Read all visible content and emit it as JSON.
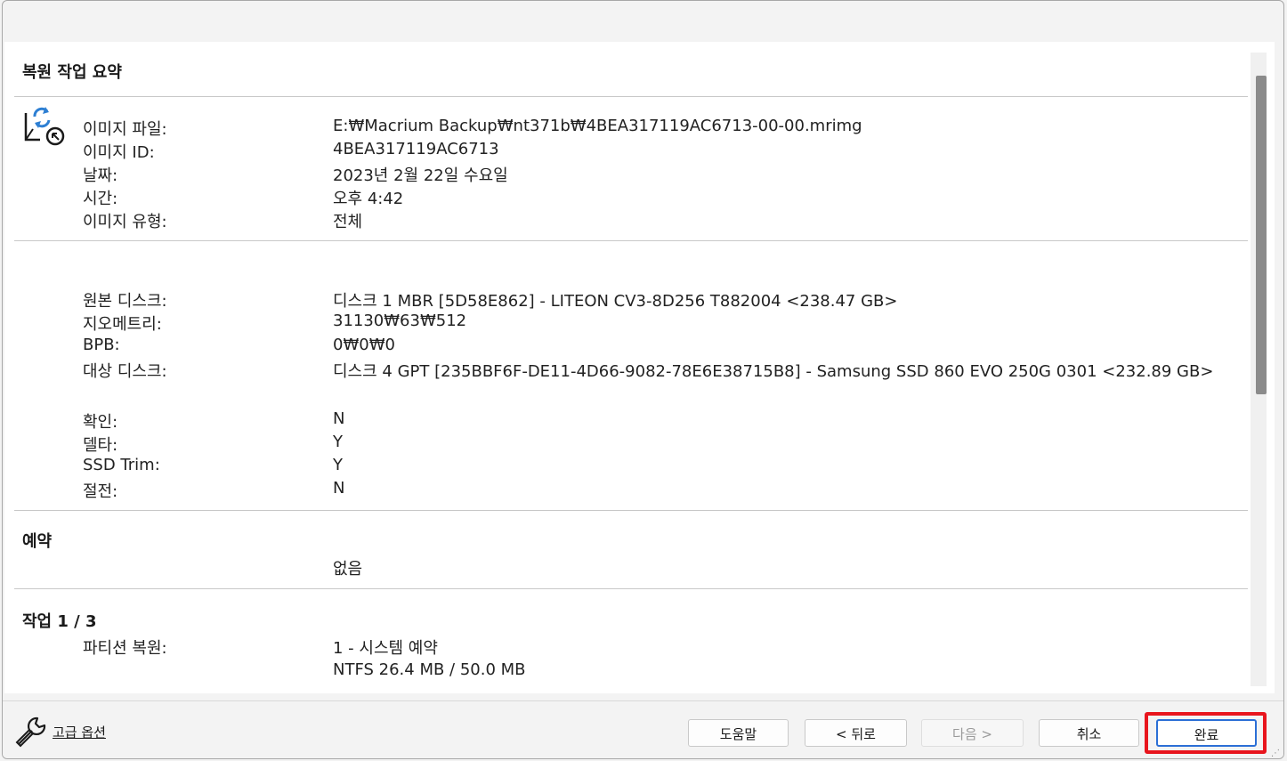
{
  "sections": {
    "summary_title": "복원 작업 요약",
    "schedule_title": "예약",
    "schedule_value": "없음",
    "task_title": "작업 1 / 3"
  },
  "image_info": [
    {
      "label": "이미지 파일:",
      "value": "E:₩Macrium Backup₩nt371b₩4BEA317119AC6713-00-00.mrimg"
    },
    {
      "label": "이미지 ID:",
      "value": "4BEA317119AC6713"
    },
    {
      "label": "날짜:",
      "value": "2023년 2월 22일 수요일"
    },
    {
      "label": "시간:",
      "value": "오후 4:42"
    },
    {
      "label": "이미지 유형:",
      "value": "전체"
    }
  ],
  "disk_info": [
    {
      "label": "원본 디스크:",
      "value": "디스크 1 MBR [5D58E862] - LITEON CV3-8D256 T882004  <238.47 GB>"
    },
    {
      "label": "지오메트리:",
      "value": "31130₩63₩512"
    },
    {
      "label": "BPB:",
      "value": "0₩0₩0"
    },
    {
      "label": "대상 디스크:",
      "value": "디스크 4 GPT [235BBF6F-DE11-4D66-9082-78E6E38715B8] - Samsung  SSD 860 EVO 250G 0301  <232.89 GB>"
    }
  ],
  "options": [
    {
      "label": "확인:",
      "value": "N"
    },
    {
      "label": "델타:",
      "value": "Y"
    },
    {
      "label": "SSD Trim:",
      "value": "Y"
    },
    {
      "label": "절전:",
      "value": "N"
    }
  ],
  "task": {
    "label": "파티션 복원:",
    "value_line1": "1 - 시스템 예약",
    "value_line2": "NTFS 26.4 MB / 50.0 MB"
  },
  "footer": {
    "advanced_options": "고급 옵션",
    "help": "도움말",
    "back": "< 뒤로",
    "next": "다음 >",
    "cancel": "취소",
    "finish": "완료"
  }
}
